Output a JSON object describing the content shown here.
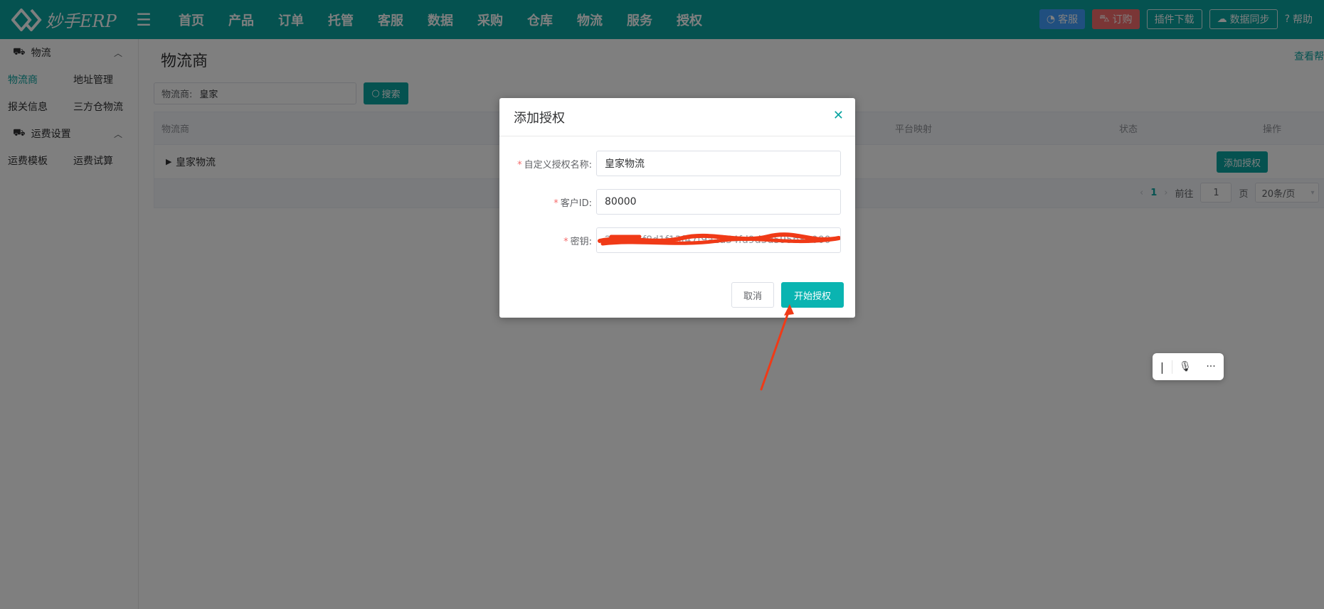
{
  "app": {
    "logo_text": "妙手ERP",
    "menu_icon": "hamburger-icon"
  },
  "nav": [
    "首页",
    "产品",
    "订单",
    "托管",
    "客服",
    "数据",
    "采购",
    "仓库",
    "物流",
    "服务",
    "授权"
  ],
  "top_actions": {
    "service": "客服",
    "order": "订购",
    "plugin": "插件下载",
    "sync": "数据同步",
    "help": "帮助"
  },
  "sidebar": {
    "groups": [
      {
        "title": "物流",
        "items": [
          "物流商",
          "地址管理",
          "报关信息",
          "三方仓物流"
        ]
      },
      {
        "title": "运费设置",
        "items": [
          "运费模板",
          "运费试算"
        ]
      }
    ],
    "active": "物流商"
  },
  "main": {
    "title": "物流商",
    "help_link": "查看帮",
    "search": {
      "label": "物流商:",
      "value": "皇家",
      "button": "搜索"
    },
    "table": {
      "headers": {
        "provider": "物流商",
        "mapping": "平台映射",
        "status": "状态",
        "operation": "操作"
      },
      "rows": [
        {
          "name": "皇家物流",
          "action": "添加授权"
        }
      ]
    },
    "pagination": {
      "current": "1",
      "goto_label": "前往",
      "goto_value": "1",
      "page_unit": "页",
      "page_size": "20条/页"
    }
  },
  "dialog": {
    "title": "添加授权",
    "fields": {
      "name_label": "自定义授权名称:",
      "name_value": "皇家物流",
      "id_label": "客户ID:",
      "id_value": "80000",
      "secret_label": "密钥:",
      "secret_value": "2055e1f8d1f13f47f9a2a54fd9d5d595b80000"
    },
    "cancel": "取消",
    "confirm": "开始授权"
  },
  "colors": {
    "brand": "#0aa4a1",
    "blue": "#409eff",
    "red": "#f56c6c",
    "annotation": "#f03a17"
  }
}
